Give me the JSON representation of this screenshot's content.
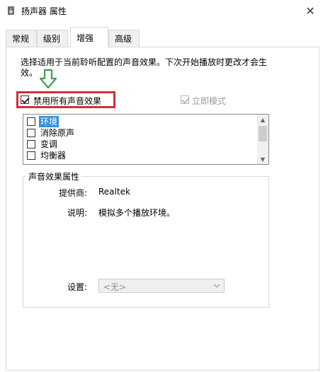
{
  "window": {
    "title": "扬声器 属性",
    "close_glyph": "✕"
  },
  "tabs": [
    {
      "label": "常规",
      "active": false
    },
    {
      "label": "级别",
      "active": false
    },
    {
      "label": "增强",
      "active": true
    },
    {
      "label": "高级",
      "active": false
    }
  ],
  "enhance": {
    "description": "选择适用于当前聆听配置的声音效果。下次开始播放时更改才会生效。",
    "disable_all": {
      "label": "禁用所有声音效果",
      "checked": true
    },
    "immediate_mode": {
      "label": "立即模式",
      "checked": true,
      "disabled": true
    },
    "effects": [
      {
        "label": "环境",
        "checked": false,
        "selected": true
      },
      {
        "label": "消除原声",
        "checked": false,
        "selected": false
      },
      {
        "label": "变调",
        "checked": false,
        "selected": false
      },
      {
        "label": "均衡器",
        "checked": false,
        "selected": false
      }
    ],
    "properties": {
      "group_title": "声音效果属性",
      "provider_label": "提供商:",
      "provider_value": "Realtek",
      "desc_label": "说明:",
      "desc_value": "模拟多个播放环境。",
      "setting_label": "设置:",
      "setting_value": "<无>"
    }
  },
  "colors": {
    "highlight_box": "#d0303a",
    "arrow_green": "#3aa24a",
    "selection_blue": "#3390e0"
  },
  "icons": {
    "window_icon": "speaker-icon",
    "annotation": "arrow-down-icon"
  }
}
